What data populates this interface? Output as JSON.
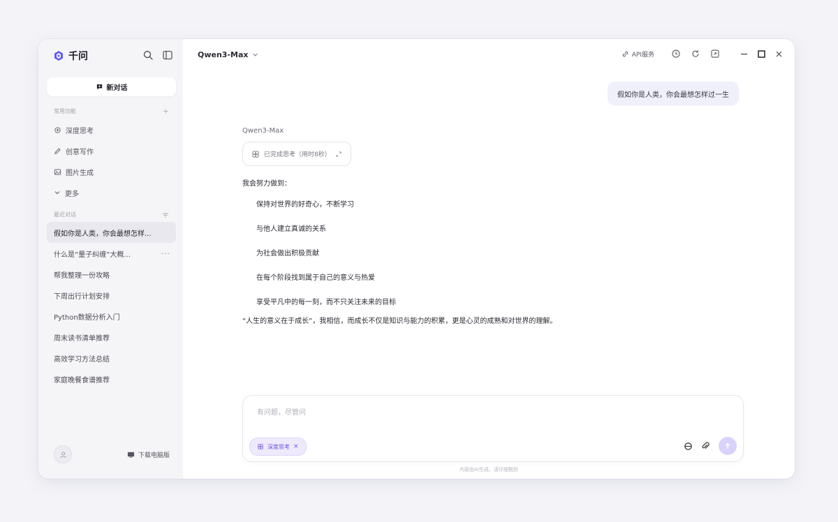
{
  "app": {
    "brand_name": "千问",
    "model_name": "Qwen3-Max",
    "api_label": "API服务"
  },
  "sidebar": {
    "new_chat_label": "新对话",
    "section_tools": "常用功能",
    "nav_items": [
      {
        "icon": "sparkle-icon",
        "label": "深度思考"
      },
      {
        "icon": "pen-icon",
        "label": "创意写作"
      },
      {
        "icon": "image-icon",
        "label": "图片生成"
      },
      {
        "icon": "chevron-down-icon",
        "label": "更多"
      }
    ],
    "section_history": "最近对话",
    "history": [
      "假如你是人类，你会最想怎样...",
      "什么是“量子纠缠”大概...",
      "帮我整理一份攻略",
      "下周出行计划安排",
      "Python数据分析入门",
      "周末读书清单推荐",
      "高效学习方法总结",
      "家庭晚餐食谱推荐"
    ],
    "download_label": "下载电脑版"
  },
  "chat": {
    "user_message": "假如你是人类，你会最想怎样过一生",
    "reply_model": "Qwen3-Max",
    "thinking_label": "已完成思考（用时8秒）",
    "reply_intro": "我会努力做到：",
    "reply_bullets": [
      "保持对世界的好奇心，不断学习",
      "与他人建立真诚的关系",
      "为社会做出积极贡献",
      "在每个阶段找到属于自己的意义与热爱",
      "享受平凡中的每一刻，而不只关注未来的目标"
    ],
    "reply_outro": "“人生的意义在于成长”，我相信，而成长不仅是知识与能力的积累，更是心灵的成熟和对世界的理解。"
  },
  "composer": {
    "placeholder": "有问题，尽管问",
    "tool_label": "深度思考"
  },
  "footer_note": "内容由AI生成，请仔细甄别",
  "colors": {
    "accent": "#615ced",
    "accent_soft": "#d9d3fb",
    "sidebar_bg": "#f5f5f7",
    "bubble_bg": "#f0f0fa"
  }
}
